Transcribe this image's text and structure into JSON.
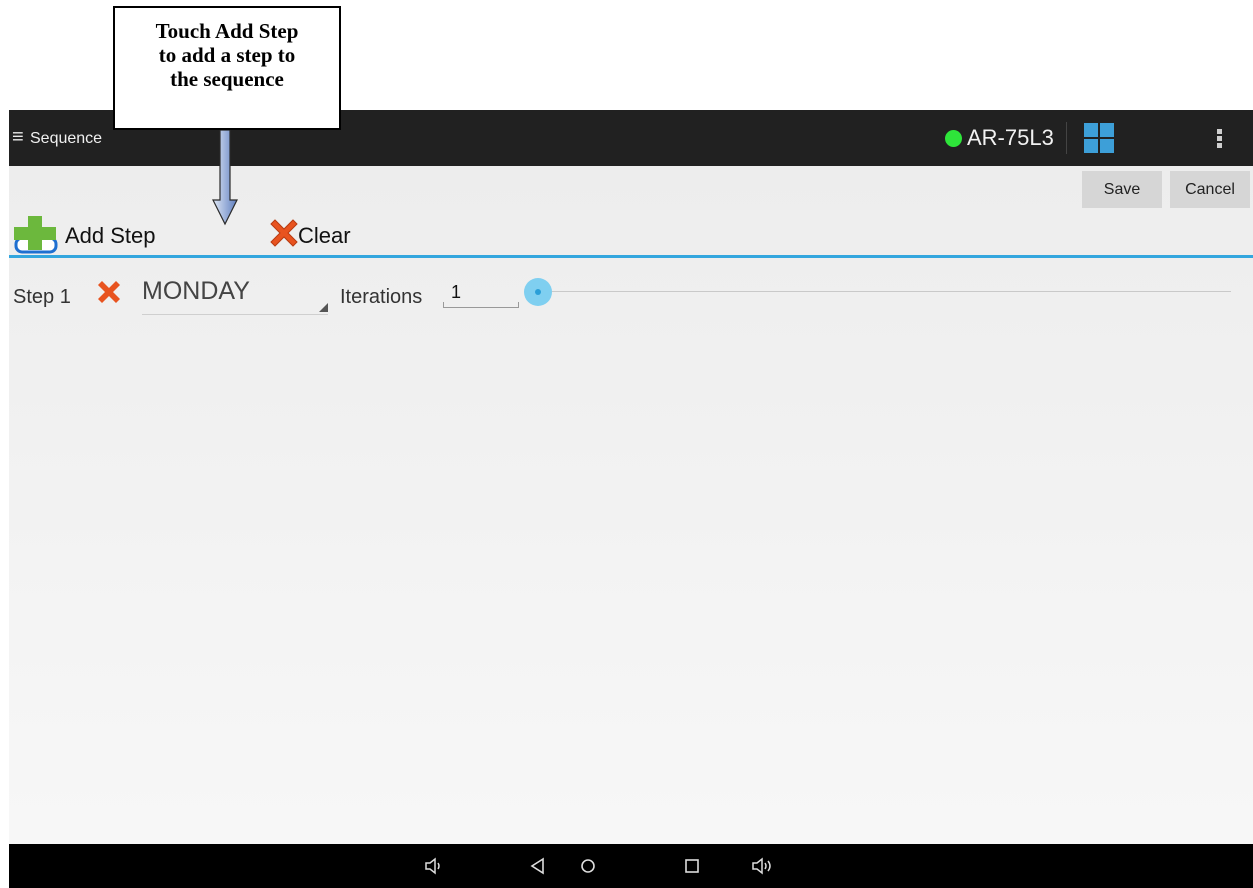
{
  "annotation": {
    "lines": [
      "Touch Add Step",
      "to add a step to",
      "the sequence"
    ]
  },
  "actionbar": {
    "menu_glyph": "≡",
    "title": "Sequence",
    "device_name": "AR-75L3",
    "status_color": "#2ee53a"
  },
  "buttons": {
    "save": "Save",
    "cancel": "Cancel"
  },
  "toolbar": {
    "add_step": "Add Step",
    "clear": "Clear"
  },
  "steps": [
    {
      "label": "Step 1",
      "day": "MONDAY",
      "iterations_label": "Iterations",
      "iterations": "1",
      "slider_value": 0
    }
  ],
  "icons": {
    "menu": "hamburger-menu-icon",
    "status": "connection-status-icon",
    "grid": "grid-view-icon",
    "overflow": "overflow-menu-icon",
    "add": "add-step-plus-icon",
    "clear": "clear-x-icon",
    "remove": "remove-step-x-icon",
    "nav": [
      "volume-down-icon",
      "back-icon",
      "home-icon",
      "recents-icon",
      "volume-up-icon"
    ]
  },
  "colors": {
    "accent": "#33a6de",
    "actionbar": "#212121",
    "clear_x": "#e8531f"
  }
}
